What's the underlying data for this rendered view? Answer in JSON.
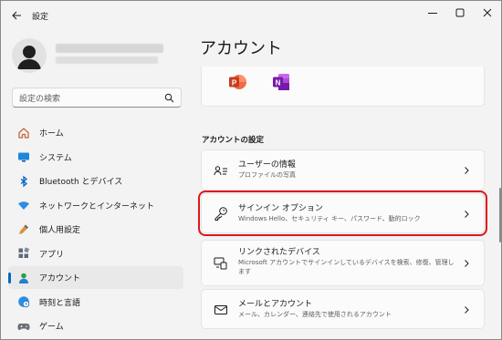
{
  "window": {
    "title": "設定"
  },
  "sidebar": {
    "search_placeholder": "設定の検索",
    "items": [
      {
        "label": "ホーム",
        "icon": "home-icon"
      },
      {
        "label": "システム",
        "icon": "system-icon"
      },
      {
        "label": "Bluetooth とデバイス",
        "icon": "bluetooth-icon"
      },
      {
        "label": "ネットワークとインターネット",
        "icon": "network-icon"
      },
      {
        "label": "個人用設定",
        "icon": "personalization-icon"
      },
      {
        "label": "アプリ",
        "icon": "apps-icon"
      },
      {
        "label": "アカウント",
        "icon": "account-icon",
        "active": true
      },
      {
        "label": "時刻と言語",
        "icon": "time-language-icon"
      },
      {
        "label": "ゲーム",
        "icon": "gaming-icon"
      }
    ]
  },
  "main": {
    "title": "アカウント",
    "section_title": "アカウントの設定",
    "cards": [
      {
        "title": "ユーザーの情報",
        "subtitle": "プロファイルの写真",
        "icon": "user-info-icon"
      },
      {
        "title": "サインイン オプション",
        "subtitle": "Windows Hello、セキュリティ キー、パスワード、動的ロック",
        "icon": "key-icon"
      },
      {
        "title": "リンクされたデバイス",
        "subtitle": "Microsoft アカウントでサインインしているデバイスを検索、修復、管理します",
        "icon": "linked-devices-icon"
      },
      {
        "title": "メールとアカウント",
        "subtitle": "メール、カレンダー、連絡先で使用されるアカウント",
        "icon": "mail-icon"
      }
    ]
  },
  "colors": {
    "accent": "#0067c0",
    "highlight": "#e0161c"
  }
}
